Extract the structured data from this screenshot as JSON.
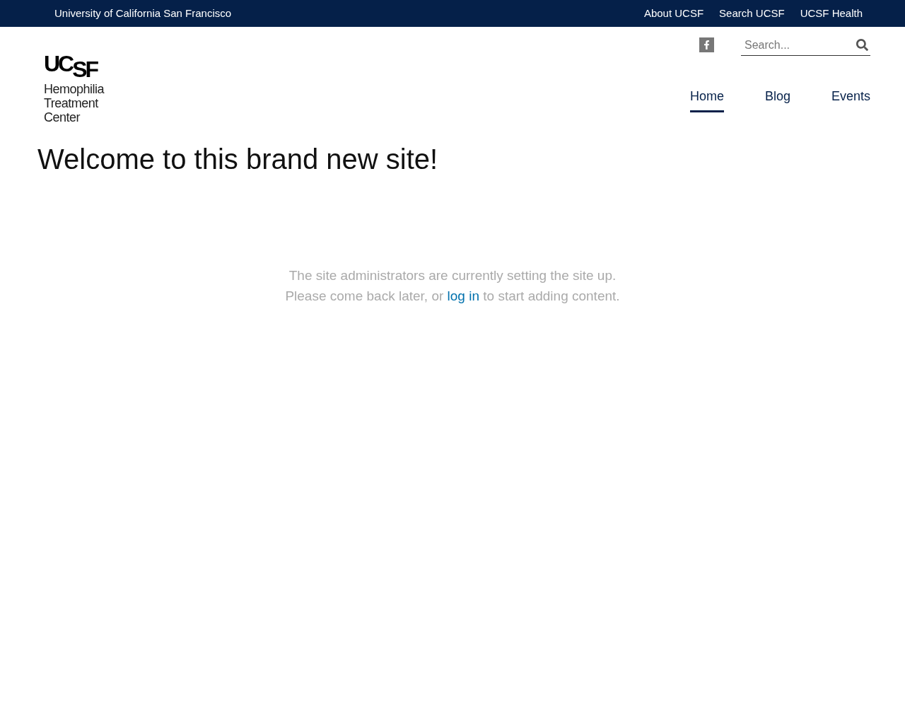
{
  "top_bar": {
    "site_name": "University of California San Francisco",
    "links": [
      "About UCSF",
      "Search UCSF",
      "UCSF Health"
    ]
  },
  "logo": {
    "mark_left": "UC",
    "mark_right": "SF",
    "lines": [
      "Hemophilia",
      "Treatment",
      "Center"
    ]
  },
  "search": {
    "placeholder": "Search..."
  },
  "nav": [
    {
      "label": "Home",
      "selected": true
    },
    {
      "label": "Blog",
      "selected": false
    },
    {
      "label": "Events",
      "selected": false
    }
  ],
  "heading": "Welcome to this brand new site!",
  "message": {
    "line1": "The site administrators are currently setting the site up.",
    "line2_before": "Please come back later, or",
    "link": "log in",
    "line2_after": "to start adding content."
  }
}
